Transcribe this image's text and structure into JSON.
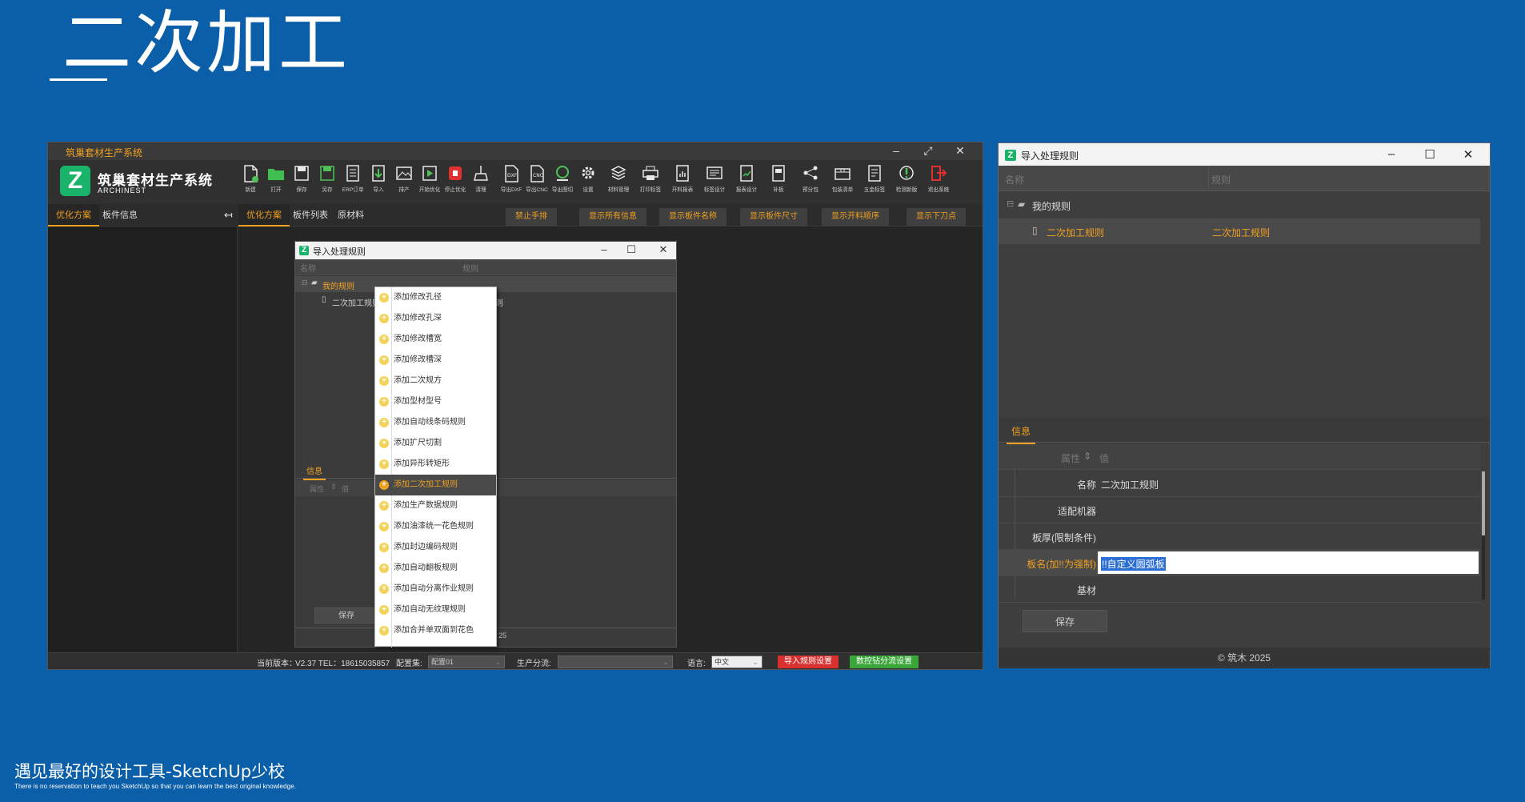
{
  "slide": {
    "title": "二次加工",
    "footer_main": "遇见最好的设计工具-SketchUp少校",
    "footer_sub": "There is no reservation to teach you SketchUp so that you can learn the best original knowledge."
  },
  "app": {
    "window_title": "筑巢套材生产系统",
    "logo_letter": "Z",
    "logo_name": "筑巢套材生产系统",
    "logo_en": "ARCHINEST",
    "win_min": "–",
    "win_max": "⤢",
    "win_close": "✕",
    "toolbar": [
      {
        "label": "新建",
        "icon": "new-file-icon",
        "color": "#4fc35a"
      },
      {
        "label": "打开",
        "icon": "open-folder-icon",
        "color": "#3fbf4f"
      },
      {
        "label": "保存",
        "icon": "save-icon",
        "color": "#e8e8e8"
      },
      {
        "label": "另存",
        "icon": "save-as-icon",
        "color": "#4fc35a"
      },
      {
        "label": "ERP订单",
        "icon": "erp-order-icon",
        "color": "#e8e8e8"
      },
      {
        "label": "导入",
        "icon": "import-icon",
        "color": "#4fc35a"
      },
      {
        "label": "排产",
        "icon": "schedule-icon",
        "color": "#e8e8e8"
      },
      {
        "label": "开始优化",
        "icon": "play-icon",
        "color": "#4fc35a"
      },
      {
        "label": "停止优化",
        "icon": "stop-icon",
        "color": "#e03030"
      },
      {
        "label": "清理",
        "icon": "broom-icon",
        "color": "#e8e8e8"
      },
      {
        "label": "导出DXF",
        "icon": "export-dxf-icon",
        "color": "#e8e8e8"
      },
      {
        "label": "导出CNC",
        "icon": "export-cnc-icon",
        "color": "#e8e8e8"
      },
      {
        "label": "导出图切",
        "icon": "export-cut-icon",
        "color": "#4fc35a"
      },
      {
        "label": "设置",
        "icon": "gear-icon",
        "color": "#e8e8e8"
      },
      {
        "label": "材料管理",
        "icon": "layers-icon",
        "color": "#e8e8e8"
      },
      {
        "label": "打印标签",
        "icon": "print-label-icon",
        "color": "#e8e8e8"
      },
      {
        "label": "开料报表",
        "icon": "cut-report-icon",
        "color": "#e8e8e8"
      },
      {
        "label": "标签设计",
        "icon": "label-design-icon",
        "color": "#e8e8e8"
      },
      {
        "label": "报表设计",
        "icon": "report-design-icon",
        "color": "#4fc35a"
      },
      {
        "label": "补板",
        "icon": "patch-board-icon",
        "color": "#e8e8e8"
      },
      {
        "label": "预分包",
        "icon": "pre-pack-icon",
        "color": "#e8e8e8"
      },
      {
        "label": "包装清单",
        "icon": "pack-list-icon",
        "color": "#e8e8e8"
      },
      {
        "label": "五金标签",
        "icon": "hardware-label-icon",
        "color": "#e8e8e8"
      },
      {
        "label": "检测新版",
        "icon": "update-icon",
        "color": "#4fc35a"
      },
      {
        "label": "退出系统",
        "icon": "exit-icon",
        "color": "#e03030"
      }
    ],
    "left_tabs": [
      "优化方案",
      "板件信息"
    ],
    "collapse_icon": "↤",
    "main_tabs": [
      "优化方案",
      "板件列表",
      "原材料"
    ],
    "orange_buttons": [
      "禁止手排",
      "显示所有信息",
      "显示板件名称",
      "显示板件尺寸",
      "显示开料顺序",
      "显示下刀点"
    ],
    "status": {
      "version_label": "当前版本：",
      "version": "V2.37 TEL：18615035857",
      "config_label": "配置集:",
      "config_value": "配置01",
      "split_label": "生产分流:",
      "split_value": "",
      "lang_label": "语言:",
      "lang_value": "中文",
      "import_rules_btn": "导入规则设置",
      "cnc_btn": "数控钻分流设置",
      "import_rules_color": "#d93030",
      "cnc_color": "#3aa63a"
    }
  },
  "small_dialog": {
    "title": "导入处理规则",
    "col_name": "名称",
    "col_rule": "规则",
    "tree_root": "我的规则",
    "tree_child": "二次加工规则",
    "tree_child_rule_partial": "则",
    "info_tab": "信息",
    "prop_col": "属性",
    "val_col": "值",
    "save": "保存",
    "footer_partial": "25"
  },
  "context_menu": {
    "items": [
      "添加修改孔径",
      "添加修改孔深",
      "添加修改槽宽",
      "添加修改槽深",
      "添加二次规方",
      "添加型材型号",
      "添加自动线条码规则",
      "添加扩尺切割",
      "添加异形转矩形",
      "添加二次加工规则",
      "添加生产数据规则",
      "添加油漆统一花色规则",
      "添加封边编码规则",
      "添加自动翻板规则",
      "添加自动分离作业规则",
      "添加自动无纹理规则",
      "添加合并单双面到花色"
    ],
    "highlighted_index": 9
  },
  "right_dialog": {
    "title": "导入处理规则",
    "col_name": "名称",
    "col_rule": "规则",
    "tree_root": "我的规则",
    "tree_child": "二次加工规则",
    "tree_child_rule": "二次加工规则",
    "info_tab": "信息",
    "prop_col": "属性",
    "val_col": "值",
    "props": [
      {
        "key": "名称",
        "value": "二次加工规则"
      },
      {
        "key": "适配机器",
        "value": ""
      },
      {
        "key": "板厚(限制条件)",
        "value": ""
      },
      {
        "key": "板名(加!!为强制)",
        "value": "!!自定义圆弧板"
      },
      {
        "key": "基材",
        "value": ""
      }
    ],
    "save": "保存",
    "footer": "© 筑木 2025"
  }
}
